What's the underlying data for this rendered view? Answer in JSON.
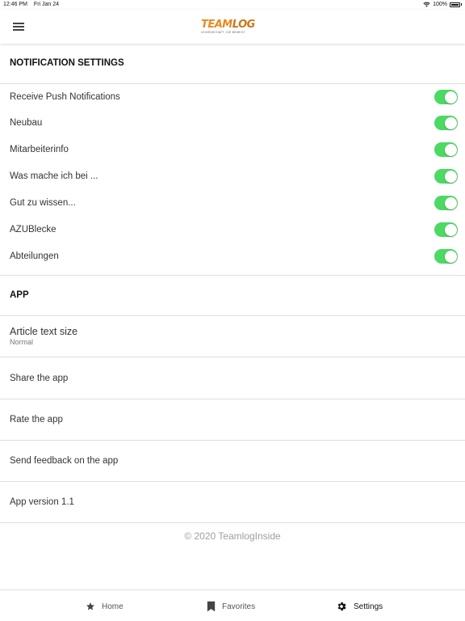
{
  "status_bar": {
    "time": "12:46 PM",
    "date": "Fri Jan 24",
    "battery": "100%"
  },
  "header": {
    "logo_text_main": "TEAM",
    "logo_text_accent": "LOG",
    "logo_tagline": "LEIDENSCHAFT, DIE BEWEGT"
  },
  "notifications": {
    "title": "NOTIFICATION SETTINGS",
    "items": [
      {
        "label": "Receive Push Notifications",
        "enabled": true
      },
      {
        "label": "Neubau",
        "enabled": true
      },
      {
        "label": "Mitarbeiterinfo",
        "enabled": true
      },
      {
        "label": "Was mache ich bei ...",
        "enabled": true
      },
      {
        "label": "Gut zu wissen...",
        "enabled": true
      },
      {
        "label": "AZUBlecke",
        "enabled": true
      },
      {
        "label": "Abteilungen",
        "enabled": true
      }
    ]
  },
  "app_section": {
    "title": "APP",
    "text_size_label": "Article text size",
    "text_size_value": "Normal",
    "share_label": "Share the app",
    "rate_label": "Rate the app",
    "feedback_label": "Send feedback on the app",
    "version_label": "App version 1.1"
  },
  "footer": {
    "copyright": "© 2020 TeamlogInside"
  },
  "bottom_nav": {
    "items": [
      {
        "label": "Home",
        "icon": "star-icon",
        "active": false
      },
      {
        "label": "Favorites",
        "icon": "bookmark-icon",
        "active": false
      },
      {
        "label": "Settings",
        "icon": "gear-icon",
        "active": true
      }
    ]
  },
  "colors": {
    "toggle_on": "#4cd964",
    "logo": "#e8891f",
    "divider": "#dedede"
  }
}
